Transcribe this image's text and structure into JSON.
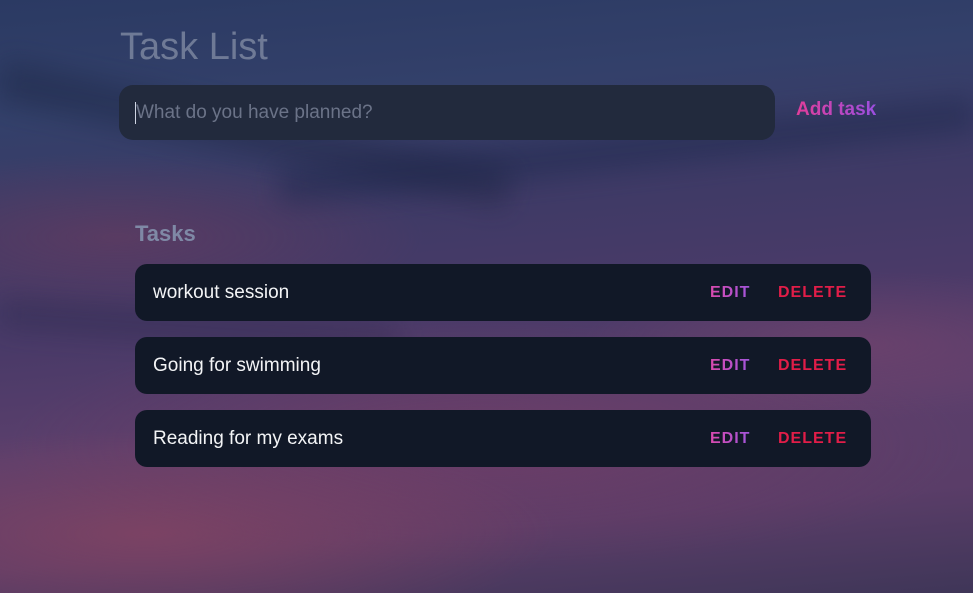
{
  "header": {
    "title": "Task List"
  },
  "new_task": {
    "placeholder": "What do you have planned?",
    "value": "",
    "add_label": "Add task"
  },
  "tasks_section": {
    "heading": "Tasks"
  },
  "tasks": [
    {
      "text": "workout session",
      "edit_label": "EDIT",
      "delete_label": "DELETE"
    },
    {
      "text": "Going for swimming",
      "edit_label": "EDIT",
      "delete_label": "DELETE"
    },
    {
      "text": "Reading for my exams",
      "edit_label": "EDIT",
      "delete_label": "DELETE"
    }
  ],
  "colors": {
    "accent_gradient_start": "#e23d9a",
    "accent_gradient_end": "#9b4fe0",
    "delete": "#e11d48",
    "task_bg": "#111827",
    "input_bg": "#222a3d"
  }
}
